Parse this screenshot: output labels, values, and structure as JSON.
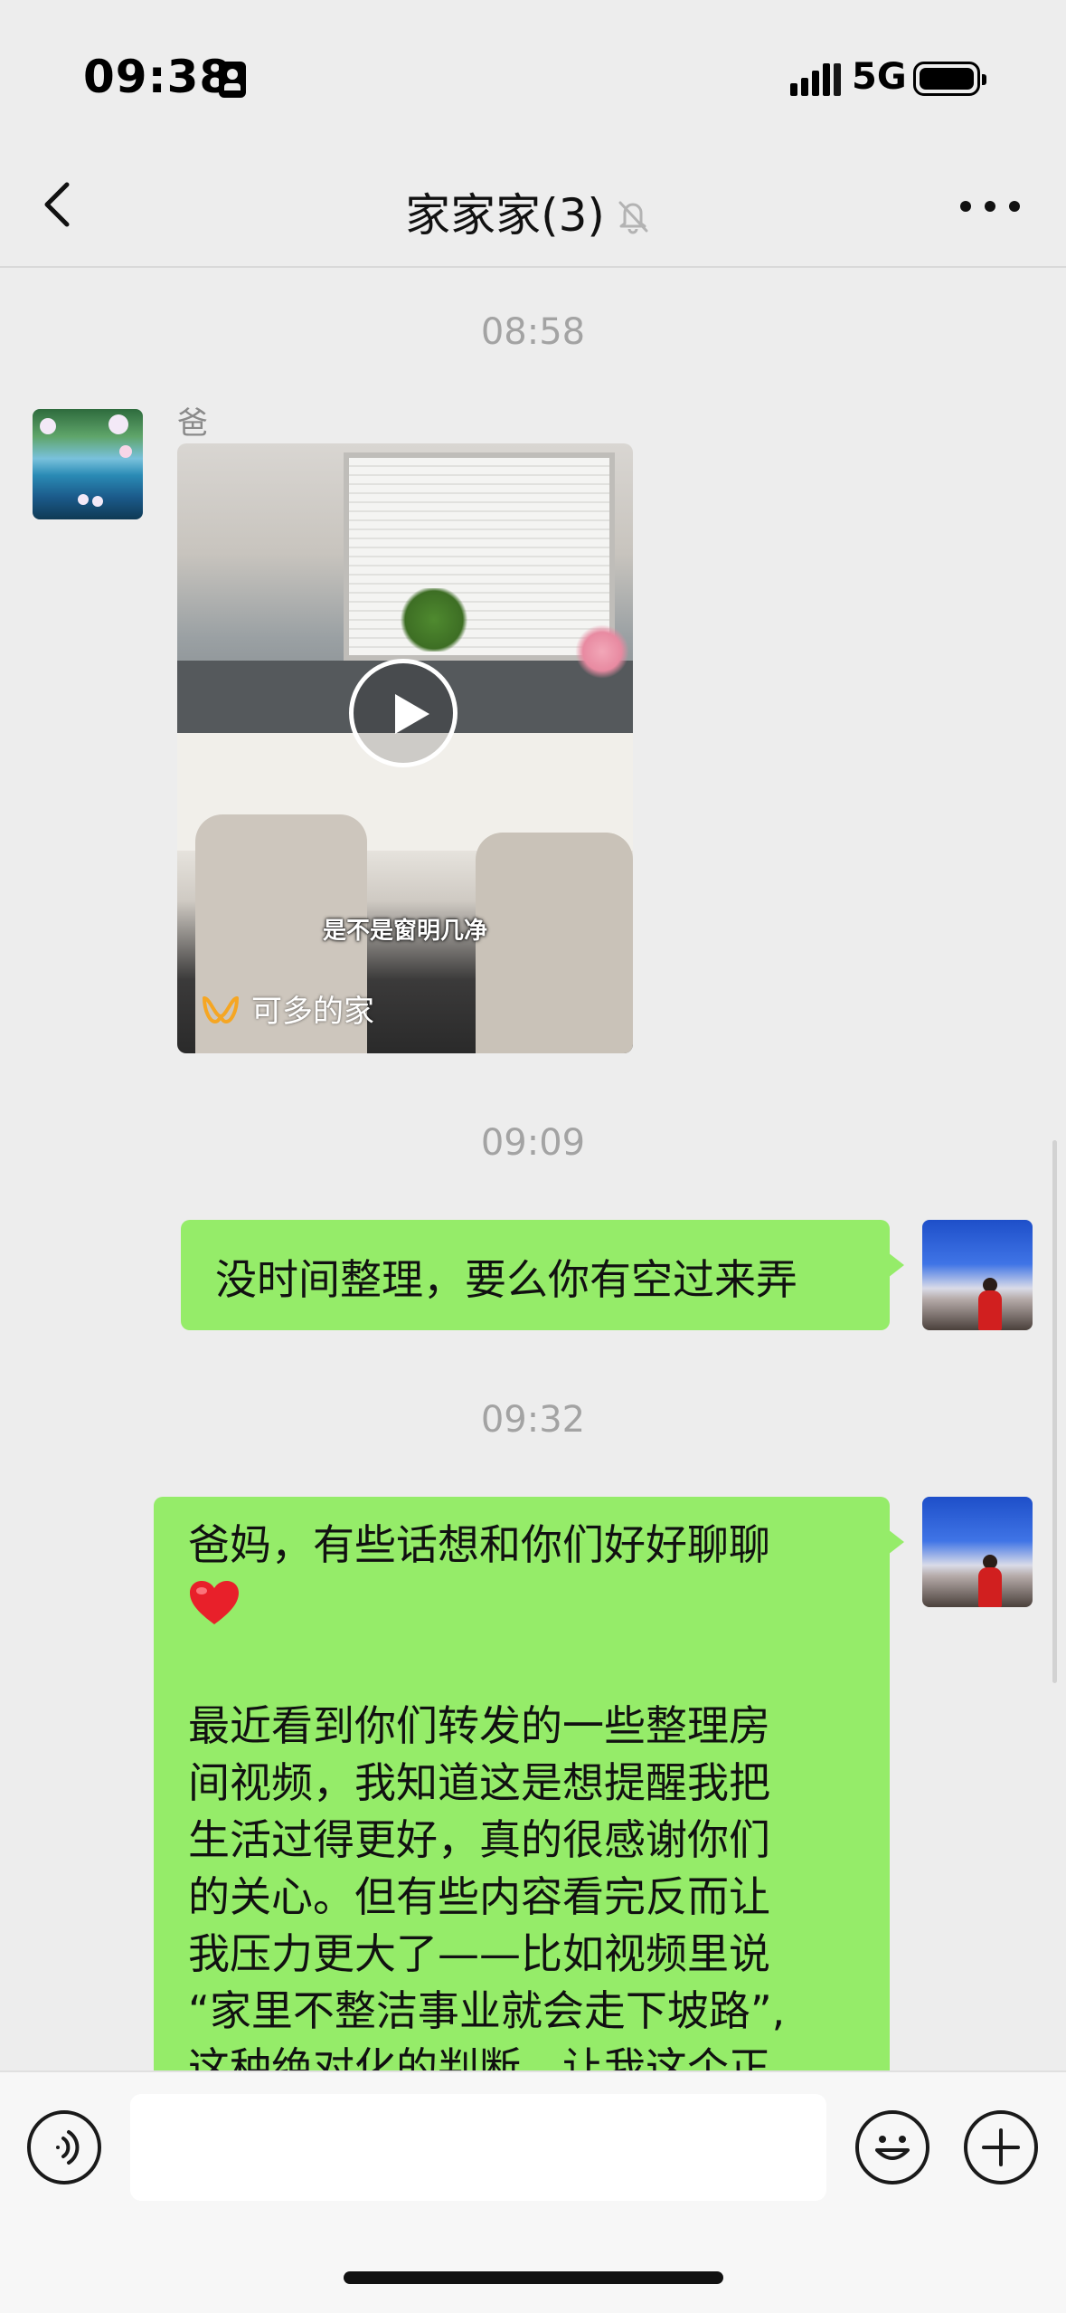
{
  "status_bar": {
    "time": "09:38",
    "network": "5G",
    "icons": [
      "id-card-icon",
      "signal-icon",
      "battery-icon"
    ]
  },
  "nav": {
    "title": "家家家(3)",
    "icons": [
      "back-icon",
      "mute-icon",
      "more-icon"
    ]
  },
  "messages": {
    "timestamp_1": "08:58",
    "dad": {
      "name": "爸",
      "video": {
        "caption": "是不是窗明几净",
        "channel": "可多的家"
      }
    },
    "timestamp_2": "09:09",
    "msg_1": "没时间整理，要么你有空过来弄",
    "timestamp_3": "09:32",
    "msg_2": {
      "line_1": "爸妈，有些话想和你们好好聊聊",
      "line_2": "最近看到你们转发的一些整理房",
      "line_3": "间视频，我知道这是想提醒我把",
      "line_4": "生活过得更好，真的很感谢你们",
      "line_5": "的关心。但有些内容看完反而让",
      "line_6": "我压力更大了——比如视频里说",
      "line_7": "“家里不整洁事业就会走下坡路”,",
      "line_8": "这种绝对化的判断，让我这个正"
    }
  },
  "input_bar": {
    "placeholder": "",
    "icons": [
      "voice-icon",
      "emoji-icon",
      "plus-icon"
    ]
  },
  "colors": {
    "background": "#ededed",
    "bubble_green": "#95ec69",
    "timestamp_gray": "#a3a3a3"
  }
}
